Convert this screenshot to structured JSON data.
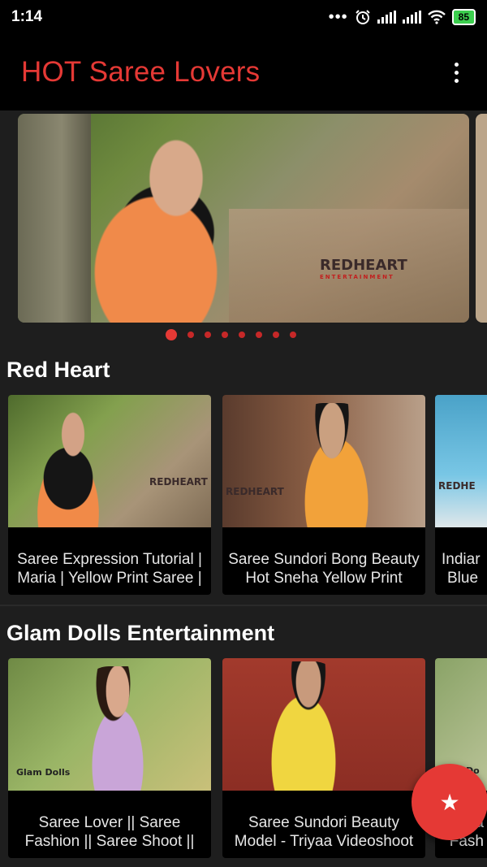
{
  "status_bar": {
    "time": "1:14",
    "dots": "•••",
    "battery": "85",
    "icons": [
      "alarm-icon",
      "signal-icon",
      "signal-icon",
      "wifi-icon",
      "battery-icon"
    ]
  },
  "app_bar": {
    "title": "HOT Saree Lovers",
    "title_color": "#e53935",
    "menu_icon": "more-vert-icon"
  },
  "banner": {
    "watermark": "REDHEART",
    "watermark_sub": "ENTERTAINMENT",
    "page_count": 8,
    "active_page": 1
  },
  "sections": [
    {
      "title": "Red Heart",
      "cards": [
        {
          "line1": "Saree Expression Tutorial |",
          "line2": "Maria | Yellow Print Saree |",
          "watermark": "REDHEART"
        },
        {
          "line1": "Saree Sundori Bong Beauty",
          "line2": "Hot Sneha Yellow Print",
          "watermark": "REDHEART"
        },
        {
          "line1": "Indiar",
          "line2": "Blue",
          "watermark": "REDHE"
        }
      ]
    },
    {
      "title": "Glam Dolls Entertainment",
      "cards": [
        {
          "line1": "Saree Lover || Saree",
          "line2": "Fashion || Saree Shoot ||",
          "watermark": "Glam Dolls"
        },
        {
          "line1": "Saree Sundori Beauty",
          "line2": "Model - Triyaa Videoshoot",
          "watermark": ""
        },
        {
          "line1": "a",
          "line2": "Fash",
          "watermark": "Do"
        }
      ]
    }
  ],
  "fab": {
    "icon": "star-icon",
    "glyph": "★",
    "color": "#e53935"
  },
  "accent_color": "#e53935"
}
